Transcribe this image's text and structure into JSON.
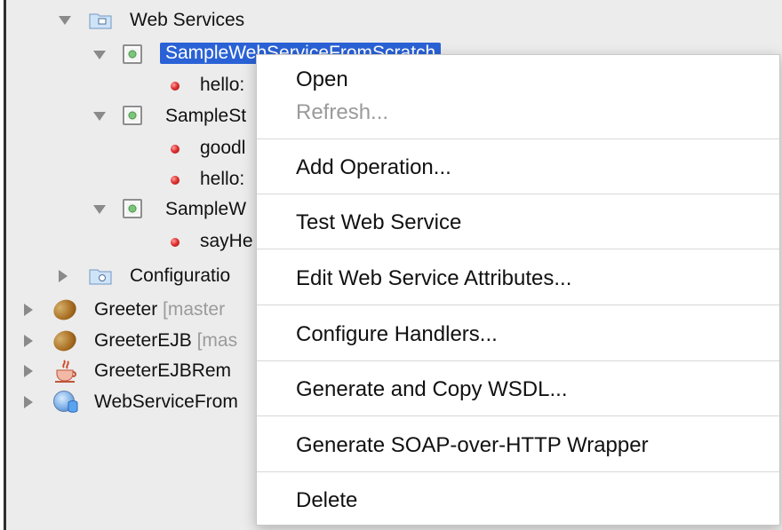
{
  "tree": {
    "web_services_label": "Web Services",
    "service1_label": "SampleWebServiceFromScratch",
    "op1_label": "hello:",
    "service2_label": "SampleSt",
    "op2_label": "goodl",
    "op3_label": "hello:",
    "service3_label": "SampleW",
    "op4_label": "sayHe",
    "config_label": "Configuratio",
    "greeter_label": "Greeter",
    "greeter_branch": "[master",
    "greeterejb_label": "GreeterEJB",
    "greeterejb_branch": "[mas",
    "greeterejbremote_label": "GreeterEJBRem",
    "webservicefrom_label": "WebServiceFrom"
  },
  "context_menu": {
    "open": "Open",
    "refresh": "Refresh...",
    "add_operation": "Add Operation...",
    "test_web_service": "Test Web Service",
    "edit_attributes": "Edit Web Service Attributes...",
    "configure_handlers": "Configure Handlers...",
    "generate_copy_wsdl": "Generate and Copy WSDL...",
    "generate_soap_wrapper": "Generate SOAP-over-HTTP Wrapper",
    "delete": "Delete"
  }
}
